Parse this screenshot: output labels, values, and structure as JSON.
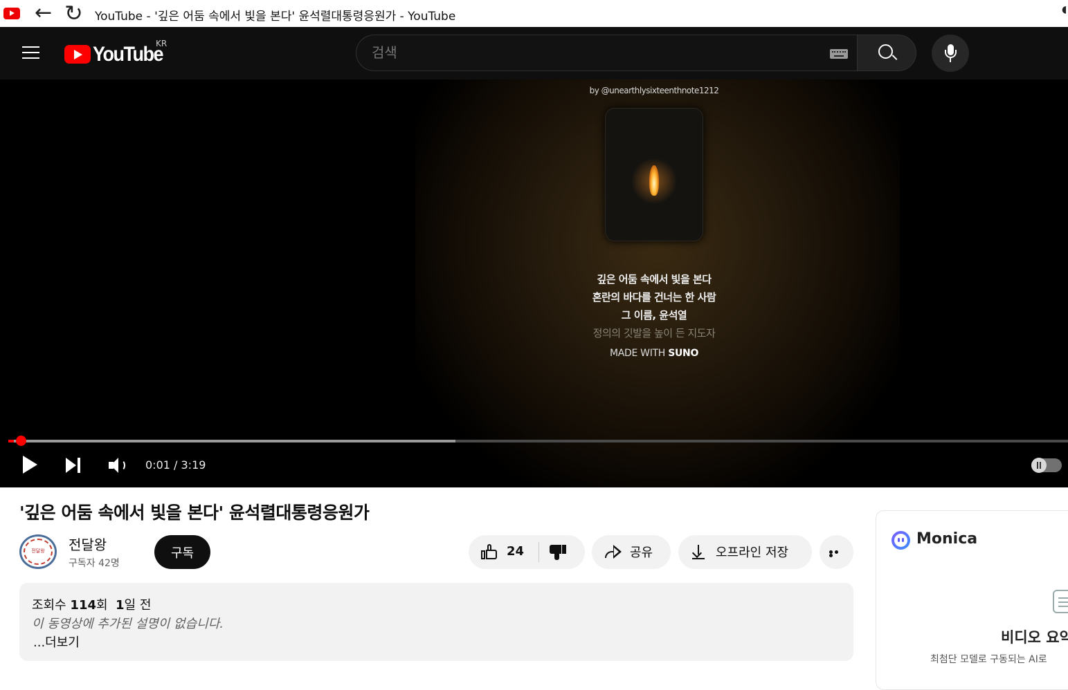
{
  "window": {
    "title": "YouTube - '깊은 어둠 속에서 빛을 본다' 윤석렬대통령응원가 - YouTube",
    "icons": [
      "youtube-favicon",
      "back-arrow-icon",
      "reload-icon"
    ]
  },
  "masthead": {
    "logo_text": "YouTube",
    "region": "KR",
    "search_placeholder": "검색",
    "icons": [
      "hamburger-icon",
      "keyboard-icon",
      "search-icon",
      "microphone-icon"
    ]
  },
  "player": {
    "credit": "by @unearthlysixteenthnote1212",
    "lyrics": [
      "깊은 어둠 속에서 빛을 본다",
      "혼란의 바다를 건너는 한 사람",
      "그 이름, 윤석열",
      "정의의 깃발을 높이 든 지도자"
    ],
    "made_with_prefix": "MADE WITH",
    "made_with_brand": "SUNO",
    "time_display": "0:01 / 3:19",
    "played_fraction": 0.005,
    "buffered_fraction": 0.422,
    "autoplay": "on",
    "accent_color": "#ff0000"
  },
  "video": {
    "title": "'깊은 어둠 속에서 빛을 본다' 윤석렬대통령응원가",
    "channel_name": "전달왕",
    "avatar_text": "전달왕",
    "subscribers": "구독자 42명",
    "subscribe_label": "구독",
    "like_count": "24",
    "share_label": "공유",
    "download_label": "오프라인 저장"
  },
  "description": {
    "views_prefix": "조회수",
    "views_count": "114",
    "views_suffix": "회",
    "date_num": "1",
    "date_suffix": "일 전",
    "empty_text": "이 동영상에 추가된 설명이 없습니다.",
    "more_label": "...더보기"
  },
  "monica": {
    "name": "Monica",
    "summary_title": "비디오 요약",
    "summary_sub": "최첨단 모델로 구동되는 AI로"
  }
}
